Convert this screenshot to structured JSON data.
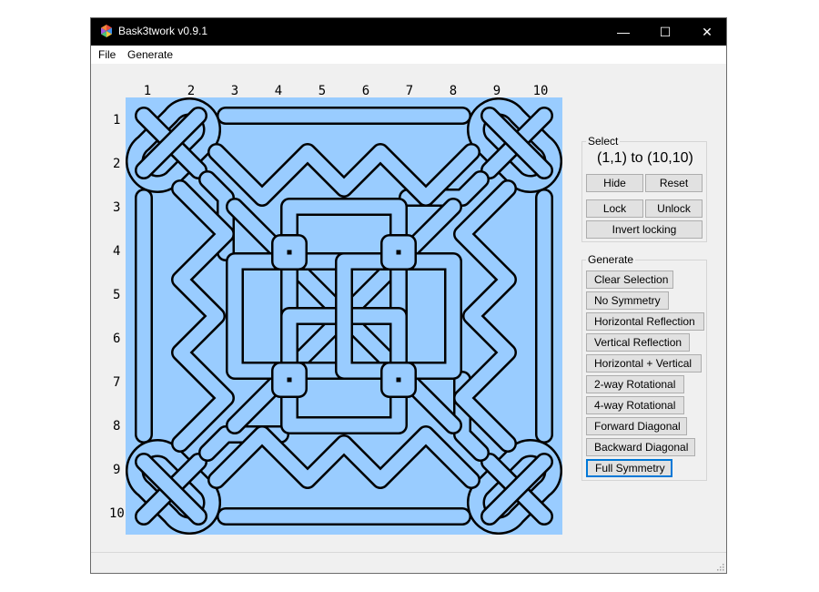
{
  "window": {
    "title": "Bask3twork v0.9.1",
    "controls": [
      "—",
      "☐",
      "✕"
    ]
  },
  "menu": {
    "items": [
      {
        "label": "File"
      },
      {
        "label": "Generate"
      }
    ]
  },
  "grid": {
    "columns": [
      "1",
      "2",
      "3",
      "4",
      "5",
      "6",
      "7",
      "8",
      "9",
      "10"
    ],
    "rows": [
      "1",
      "2",
      "3",
      "4",
      "5",
      "6",
      "7",
      "8",
      "9",
      "10"
    ],
    "background_color": "#99ccff",
    "strand_fill": "#99ccff",
    "strand_outline": "#000000"
  },
  "select": {
    "legend": "Select",
    "range_text": "(1,1) to (10,10)",
    "hide_label": "Hide",
    "reset_label": "Reset",
    "lock_label": "Lock",
    "unlock_label": "Unlock",
    "invert_label": "Invert locking"
  },
  "generate": {
    "legend": "Generate",
    "buttons": [
      {
        "label": "Clear Selection"
      },
      {
        "label": "No Symmetry"
      },
      {
        "label": "Horizontal Reflection"
      },
      {
        "label": "Vertical Reflection"
      },
      {
        "label": "Horizontal + Vertical"
      },
      {
        "label": "2-way Rotational"
      },
      {
        "label": "4-way Rotational"
      },
      {
        "label": "Forward Diagonal"
      },
      {
        "label": "Backward Diagonal"
      },
      {
        "label": "Full Symmetry"
      }
    ],
    "focused": "Full Symmetry"
  }
}
